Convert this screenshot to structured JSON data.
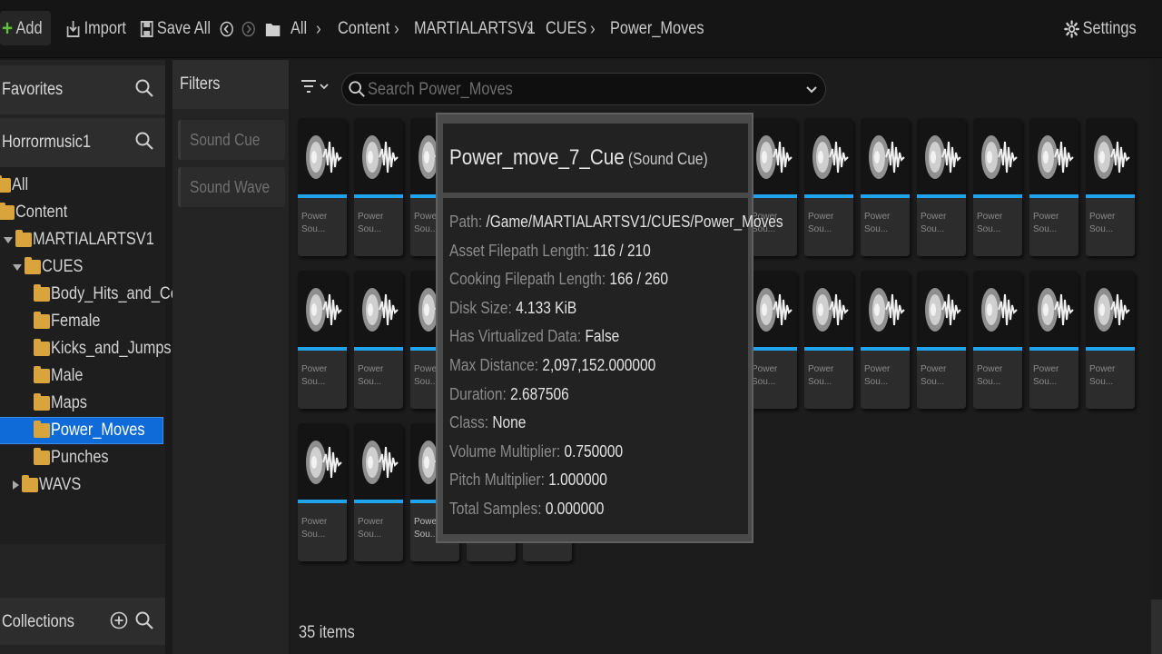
{
  "toolbar": {
    "add_label": "Add",
    "import_label": "Import",
    "save_all_label": "Save All",
    "settings_label": "Settings",
    "breadcrumb": [
      "All",
      "Content",
      "MARTIALARTSV1",
      "CUES",
      "Power_Moves"
    ]
  },
  "sidebar": {
    "favorites_title": "Favorites",
    "project_title": "Horrormusic1",
    "collections_title": "Collections",
    "tree": [
      {
        "label": "All"
      },
      {
        "label": "Content"
      },
      {
        "label": "MARTIALARTSV1"
      },
      {
        "label": "CUES"
      },
      {
        "label": "Body_Hits_and_Com"
      },
      {
        "label": "Female"
      },
      {
        "label": "Kicks_and_Jumps"
      },
      {
        "label": "Male"
      },
      {
        "label": "Maps"
      },
      {
        "label": "Power_Moves",
        "selected": true
      },
      {
        "label": "Punches"
      },
      {
        "label": "WAVS"
      }
    ]
  },
  "filters": {
    "title": "Filters",
    "items": [
      "Sound Cue",
      "Sound Wave"
    ]
  },
  "main": {
    "search_placeholder": "Search Power_Moves",
    "items_count": "35 items",
    "asset_name_line1": "Power",
    "asset_name_line2": "Sou...",
    "accent_color": "#1fa3ef"
  },
  "tooltip": {
    "title": "Power_move_7_Cue",
    "type": "(Sound Cue)",
    "rows": [
      {
        "key": "Path:",
        "value": "/Game/MARTIALARTSV1/CUES/Power_Moves"
      },
      {
        "key": "Asset Filepath Length:",
        "value": "116 / 210"
      },
      {
        "key": "Cooking Filepath Length:",
        "value": "166 / 260"
      },
      {
        "key": "Disk Size:",
        "value": "4.133 KiB"
      },
      {
        "key": "Has Virtualized Data:",
        "value": "False"
      },
      {
        "key": "Max Distance:",
        "value": "2,097,152.000000"
      },
      {
        "key": "Duration:",
        "value": "2.687506"
      },
      {
        "key": "Class:",
        "value": "None"
      },
      {
        "key": "Volume Multiplier:",
        "value": "0.750000"
      },
      {
        "key": "Pitch Multiplier:",
        "value": "1.000000"
      },
      {
        "key": "Total Samples:",
        "value": "0.000000"
      }
    ]
  },
  "icons": {
    "add": "plus-icon",
    "import": "import-icon",
    "save_all": "save-icon",
    "back": "back-arrow-icon",
    "forward": "forward-arrow-icon",
    "folder": "folder-icon",
    "settings": "gear-icon",
    "search": "search-icon",
    "filter": "filter-icon",
    "asset": "sound-cue-icon"
  }
}
